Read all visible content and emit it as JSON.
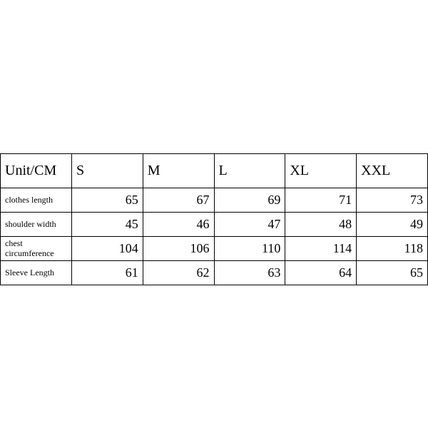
{
  "chart_data": {
    "type": "table",
    "title": "",
    "unit_label": "Unit/CM",
    "columns": [
      "S",
      "M",
      "L",
      "XL",
      "XXL"
    ],
    "rows": [
      {
        "label": "clothes length",
        "values": [
          65,
          67,
          69,
          71,
          73
        ]
      },
      {
        "label": "shoulder width",
        "values": [
          45,
          46,
          47,
          48,
          49
        ]
      },
      {
        "label": "chest circumference",
        "values": [
          104,
          106,
          110,
          114,
          118
        ]
      },
      {
        "label": "Sleeve Length",
        "values": [
          61,
          62,
          63,
          64,
          65
        ]
      }
    ]
  }
}
